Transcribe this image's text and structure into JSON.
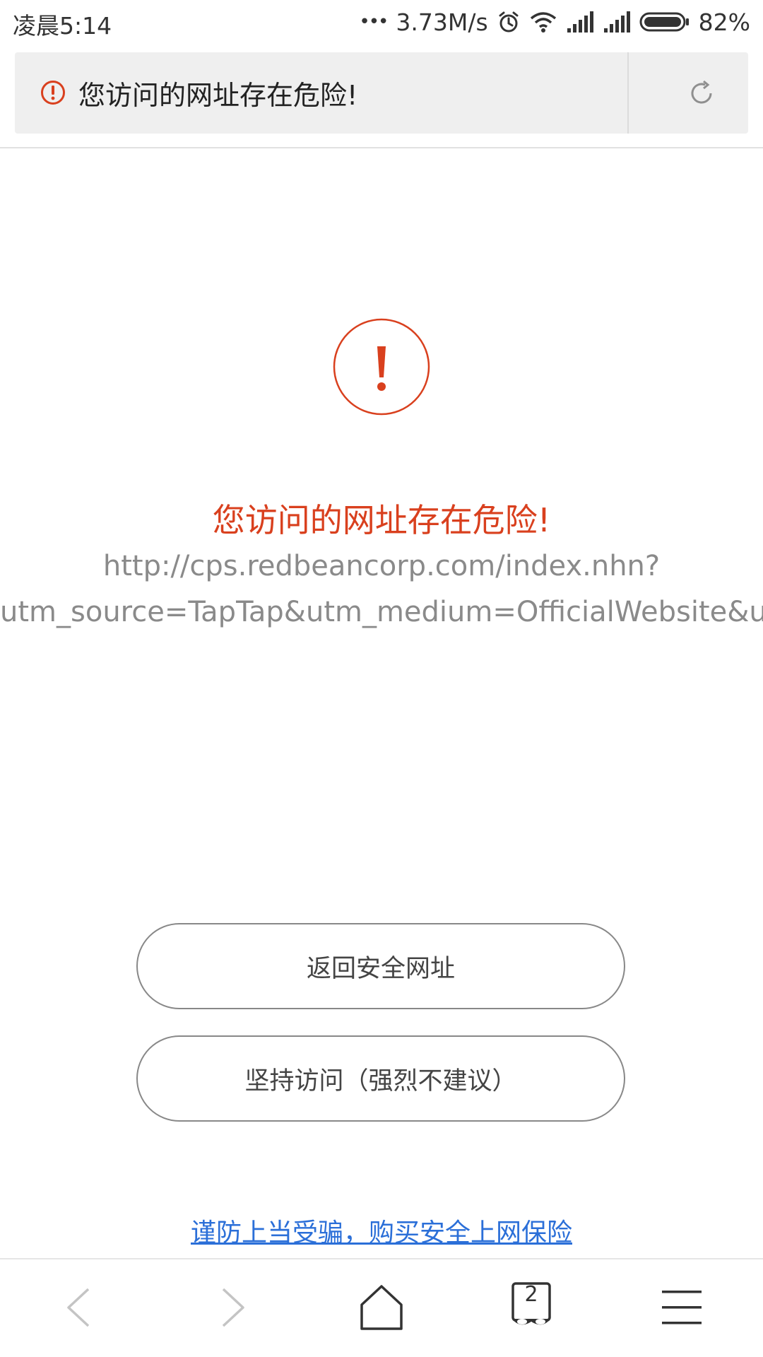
{
  "status_bar": {
    "time": "凌晨5:14",
    "dots": "•••",
    "network_speed": "3.73M/s",
    "battery": "82%",
    "icons": [
      "alarm-icon",
      "wifi-icon",
      "signal-icon",
      "signal-icon",
      "battery-icon"
    ]
  },
  "address_bar": {
    "text": "您访问的网址存在危险!",
    "icons": [
      "warning-icon",
      "refresh-icon"
    ]
  },
  "warning": {
    "title": "您访问的网址存在危险!",
    "url_line1": "http://cps.redbeancorp.com/index.nhn?",
    "url_line2": "utm_source=TapTap&utm_medium=OfficialWebsite&utm_c"
  },
  "buttons": {
    "return_safe": "返回安全网址",
    "continue_visit": "坚持访问（强烈不建议）"
  },
  "insurance_link": "谨防上当受骗，购买安全上网保险",
  "bottom_nav": {
    "tab_count": "2",
    "icons": [
      "back-icon",
      "forward-icon",
      "home-icon",
      "tabs-icon",
      "menu-icon"
    ]
  },
  "colors": {
    "danger": "#d9401e",
    "link": "#2b6fd8",
    "url_gray": "#8a8a8a"
  }
}
